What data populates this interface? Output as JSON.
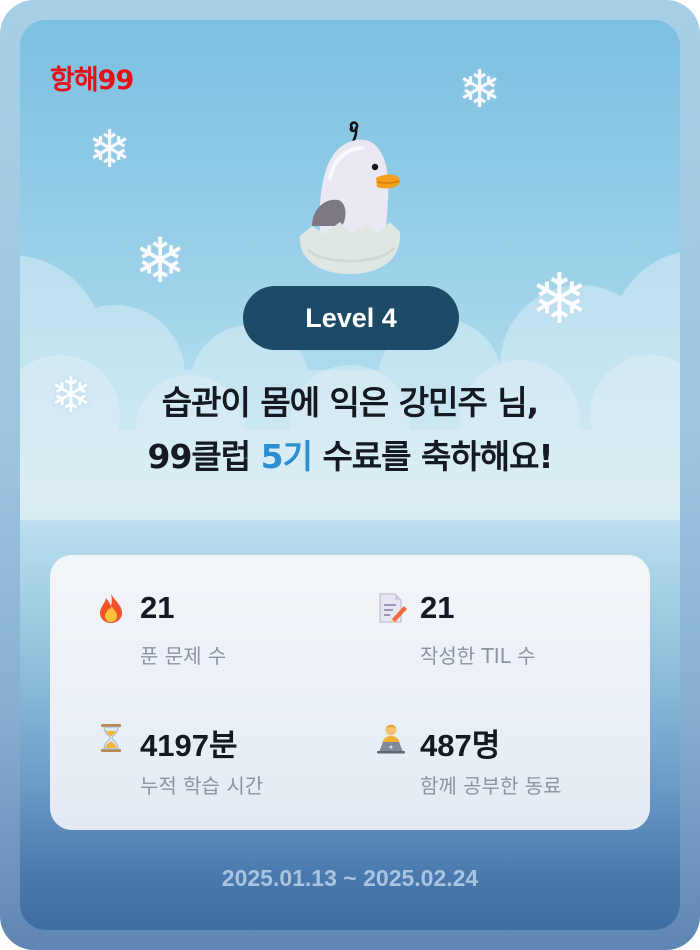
{
  "brand": {
    "logo_text": "항해99",
    "logo_color": "#e3111b"
  },
  "mascot": {
    "icon": "duckling-in-eggshell-icon",
    "number": "9"
  },
  "level": {
    "label": "Level 4"
  },
  "headline": {
    "line1": "습관이 몸에 익은 강민주 님,",
    "line2_prefix": "99클럽 ",
    "line2_accent": "5기",
    "line2_suffix": " 수료를 축하해요!",
    "accent_color": "#2b8fd1"
  },
  "stats": [
    {
      "icon": "fire-icon",
      "value": "21",
      "label": "푼 문제 수"
    },
    {
      "icon": "memo-pencil-icon",
      "value": "21",
      "label": "작성한 TIL 수"
    },
    {
      "icon": "hourglass-icon",
      "value": "4197분",
      "label": "누적 학습 시간"
    },
    {
      "icon": "person-at-laptop-icon",
      "value": "487명",
      "label": "함께 공부한 동료"
    }
  ],
  "period": {
    "text": "2025.01.13 ~ 2025.02.24"
  },
  "colors": {
    "level_pill": "#1d4a66",
    "background_top": "#7dbfdf",
    "background_bottom": "#3f6ea3"
  }
}
